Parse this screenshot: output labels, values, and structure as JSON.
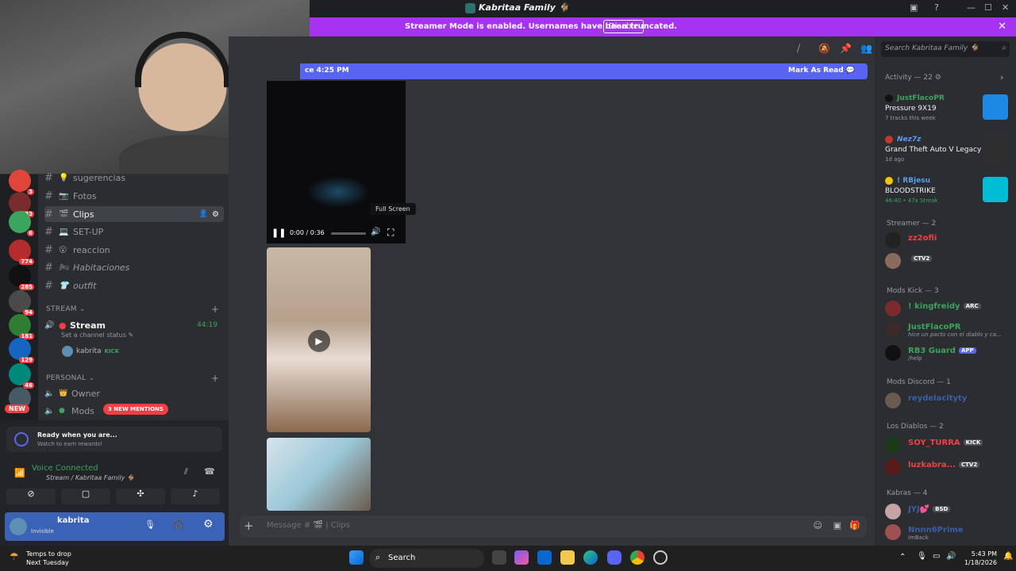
{
  "window": {
    "title": "Kabritaa Family 🐐"
  },
  "streamer_banner": {
    "message": "Streamer Mode is enabled. Usernames have been truncated.",
    "disable_label": "Disable"
  },
  "servers": [
    {
      "badge": "3",
      "color": "#e0453a"
    },
    {
      "badge": "433",
      "color": "#7a2b2b"
    },
    {
      "badge": "6",
      "color": "#3ba55d"
    },
    {
      "badge": "774",
      "color": "#b32d2d"
    },
    {
      "badge": "285",
      "color": "#111111"
    },
    {
      "badge": "94",
      "color": "#4a4a4a"
    },
    {
      "badge": "181",
      "color": "#2e7d32"
    },
    {
      "badge": "129",
      "color": "#1565c0"
    },
    {
      "badge": "46",
      "color": "#00897b"
    },
    {
      "badge": "",
      "color": "#455a64"
    }
  ],
  "new_badge": "NEW",
  "channels": [
    {
      "name": "sugerencias",
      "emoji": "💡",
      "active": false
    },
    {
      "name": "Fotos",
      "emoji": "📷",
      "active": false
    },
    {
      "name": "Clips",
      "emoji": "🎬",
      "active": true
    },
    {
      "name": "SET-UP",
      "emoji": "💻",
      "active": false
    },
    {
      "name": "reaccion",
      "emoji": "😮",
      "active": false
    },
    {
      "name": "Habitaciones",
      "emoji": "🛏",
      "active": false
    },
    {
      "name": "outfit",
      "emoji": "👕",
      "active": false
    }
  ],
  "categories": {
    "stream": "STREAM",
    "personal": "PERSONAL"
  },
  "voice_channel": {
    "name": "Stream",
    "timer": "44:19",
    "status_hint": "Set a channel status",
    "user": "kabrita",
    "user_badge": "KICK"
  },
  "personal_channels": [
    {
      "name": "Owner"
    },
    {
      "name": "Mods"
    }
  ],
  "mentions_pill": "3 NEW MENTIONS",
  "promo": {
    "title": "Ready when you are...",
    "subtitle": "Watch to earn rewards!"
  },
  "voice_status": {
    "label": "Voice Connected",
    "location": "Stream / Kabritaa Family 🐐"
  },
  "user_panel": {
    "username": "kabrita",
    "status": "Invisible"
  },
  "new_messages": {
    "since": "ce 4:25 PM",
    "mark_read": "Mark As Read"
  },
  "video_player": {
    "time": "0:00 / 0:36",
    "tooltip": "Full Screen",
    "progress": 0.0,
    "volume": 0.7
  },
  "composer": {
    "placeholder": "Message #",
    "channel": "Clips"
  },
  "members_search": {
    "placeholder": "Search Kabritaa Family 🐐"
  },
  "activity": {
    "label": "Activity — 22",
    "cards": [
      {
        "user": "JustFlacoPR",
        "user_color": "#3ba55d",
        "title": "Pressure 9X19",
        "sub": "7 tracks this week",
        "art": "#1e88e5"
      },
      {
        "user": "Nez7z",
        "user_color": "#5b9cf2",
        "title": "Grand Theft Auto V Legacy",
        "sub": "1d ago",
        "art": "#2e2e2e"
      },
      {
        "user": "! RBjesu",
        "user_color": "#5b9cf2",
        "title": "BLOODSTRIKE",
        "sub": "46:40  •  47x Streak",
        "art": "#00bcd4"
      }
    ]
  },
  "roles": [
    {
      "label": "Streamer — 2",
      "members": [
        {
          "name": "zz2ofii",
          "color": "#f23f43",
          "sub": "",
          "tag": "",
          "tag_color": ""
        },
        {
          "name": "",
          "color": "#f2f3f5",
          "sub": "",
          "tag": "CTV2",
          "tag_color": "#4e5058"
        }
      ]
    },
    {
      "label": "Mods Kick — 3",
      "members": [
        {
          "name": "! kingfreidy",
          "color": "#3ba55d",
          "sub": "",
          "tag": "ARC",
          "tag_color": "#4e5058"
        },
        {
          "name": "JustFlacoPR",
          "color": "#3ba55d",
          "sub": "hice un pacto con el diablo y ca...",
          "tag": "",
          "tag_color": ""
        },
        {
          "name": "RB3 Guard",
          "color": "#3ba55d",
          "sub": "/help",
          "tag": "APP",
          "tag_color": "#5865f2"
        }
      ]
    },
    {
      "label": "Mods Discord — 1",
      "members": [
        {
          "name": "reydelacityty",
          "color": "#3a5ea8",
          "sub": "",
          "tag": "",
          "tag_color": ""
        }
      ]
    },
    {
      "label": "Los Diablos — 2",
      "members": [
        {
          "name": "SOY_TURRA",
          "color": "#f23f43",
          "sub": "",
          "tag": "KICK",
          "tag_color": "#4e5058"
        },
        {
          "name": "luzkabra...",
          "color": "#f23f43",
          "sub": "",
          "tag": "CTV2",
          "tag_color": "#4e5058"
        }
      ]
    },
    {
      "label": "Kabras — 4",
      "members": [
        {
          "name": "JYJ💕",
          "color": "#3a5ea8",
          "sub": "",
          "tag": "BSD",
          "tag_color": "#4e5058"
        },
        {
          "name": "Nnnn6Prime",
          "color": "#3a5ea8",
          "sub": "ImBack",
          "tag": "",
          "tag_color": ""
        }
      ]
    }
  ],
  "taskbar": {
    "weather_line1": "Temps to drop",
    "weather_line2": "Next Tuesday",
    "search_label": "Search",
    "time": "5:43 PM",
    "date": "1/18/2026"
  }
}
